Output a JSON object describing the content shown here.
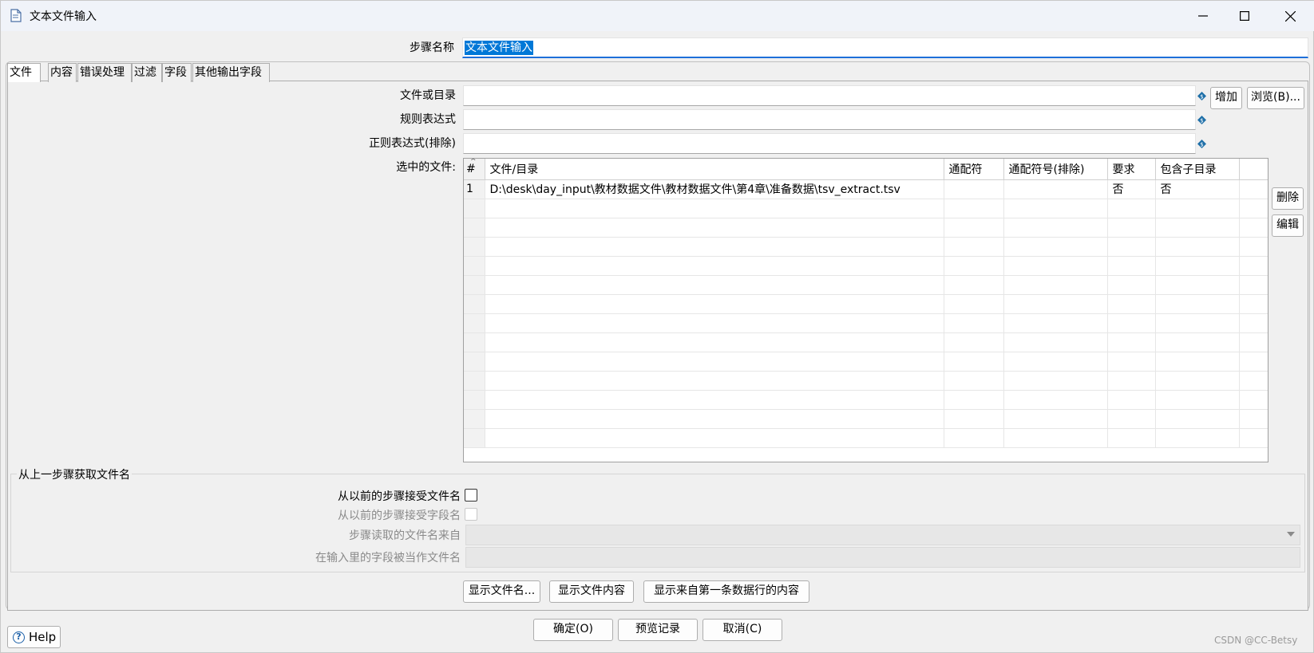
{
  "window": {
    "title": "文本文件输入"
  },
  "step_name": {
    "label": "步骤名称",
    "value": "文本文件输入"
  },
  "tabs": [
    {
      "label": "文件"
    },
    {
      "label": "内容"
    },
    {
      "label": "错误处理"
    },
    {
      "label": "过滤"
    },
    {
      "label": "字段"
    },
    {
      "label": "其他输出字段"
    }
  ],
  "file_section": {
    "file_or_dir_label": "文件或目录",
    "regex_label": "规则表达式",
    "regex_exclude_label": "正则表达式(排除)",
    "selected_files_label": "选中的文件:",
    "add_button": "增加",
    "browse_button": "浏览(B)...",
    "delete_button": "删除",
    "edit_button": "编辑"
  },
  "grid": {
    "headers": [
      "#",
      "文件/目录",
      "通配符",
      "通配符号(排除)",
      "要求",
      "包含子目录"
    ],
    "rows": [
      [
        "1",
        "D:\\desk\\day_input\\教材数据文件\\教材数据文件\\第4章\\准备数据\\tsv_extract.tsv",
        "",
        "",
        "否",
        "否"
      ]
    ]
  },
  "prev_step_group": {
    "title": "从上一步骤获取文件名",
    "accept_filenames_label": "从以前的步骤接受文件名",
    "accept_fieldnames_label": "从以前的步骤接受字段名",
    "step_source_label": "步骤读取的文件名来自",
    "field_as_filename_label": "在输入里的字段被当作文件名"
  },
  "action_buttons": {
    "show_filenames": "显示文件名...",
    "show_file_content": "显示文件内容",
    "show_first_row_content": "显示来自第一条数据行的内容"
  },
  "footer": {
    "help": "Help",
    "ok": "确定(O)",
    "preview": "预览记录",
    "cancel": "取消(C)",
    "watermark": "CSDN @CC-Betsy"
  }
}
